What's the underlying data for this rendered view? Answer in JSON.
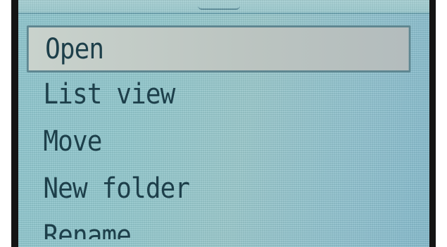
{
  "menu": {
    "items": [
      {
        "label": "Open",
        "selected": true
      },
      {
        "label": "List view",
        "selected": false
      },
      {
        "label": "Move",
        "selected": false
      },
      {
        "label": "New folder",
        "selected": false
      },
      {
        "label": "Rename",
        "selected": false
      }
    ]
  },
  "colors": {
    "screen_background": "#93c9ce",
    "text": "#1d3f4a",
    "selection_background": "#c4cdc8",
    "selection_border": "#5f8791",
    "bezel": "#141414"
  }
}
